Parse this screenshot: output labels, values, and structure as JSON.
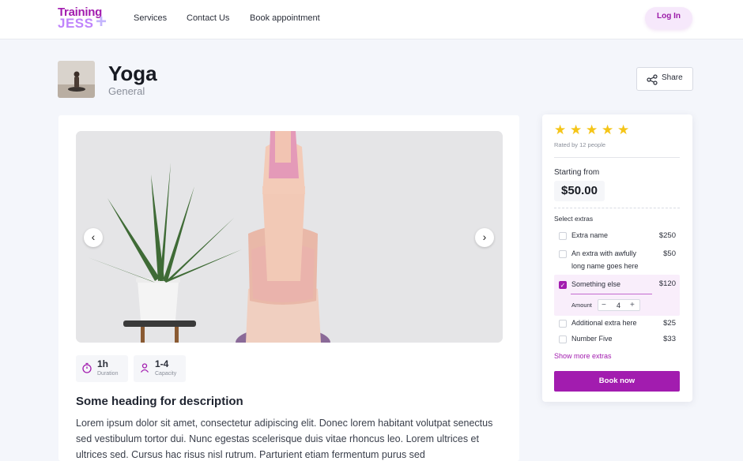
{
  "nav": {
    "logo_line1": "Training",
    "logo_line2": "JESS",
    "logo_plus": "+",
    "links": [
      "Services",
      "Contact Us",
      "Book appointment"
    ],
    "login": "Log In"
  },
  "service": {
    "title": "Yoga",
    "category": "General",
    "share": "Share"
  },
  "gallery": {
    "prev": "‹",
    "next": "›"
  },
  "stats": [
    {
      "value": "1h",
      "label": "Duration",
      "icon": "stopwatch-icon"
    },
    {
      "value": "1-4",
      "label": "Capacity",
      "icon": "person-icon"
    }
  ],
  "description": {
    "heading": "Some heading for description",
    "body": "Lorem ipsum dolor sit amet, consectetur adipiscing elit. Donec lorem habitant volutpat senectus sed vestibulum tortor dui. Nunc egestas scelerisque duis vitae rhoncus leo. Lorem ultrices et ultrices sed. Cursus hac risus nisl rutrum. Parturient etiam fermentum purus sed"
  },
  "booking": {
    "rating_stars": 5,
    "rated_by": "Rated by 12 people",
    "starting_label": "Starting from",
    "price": "$50.00",
    "extras_label": "Select extras",
    "extras": [
      {
        "name": "Extra name",
        "price": "$250",
        "checked": false
      },
      {
        "name": "An extra with awfully long name goes here",
        "price": "$50",
        "checked": false
      },
      {
        "name": "Something else",
        "price": "$120",
        "checked": true
      },
      {
        "name": "Additional extra here",
        "price": "$25",
        "checked": false
      },
      {
        "name": "Number Five",
        "price": "$33",
        "checked": false
      }
    ],
    "amount_label": "Amount",
    "amount_minus": "−",
    "amount_value": "4",
    "amount_plus": "+",
    "show_more": "Show more extras",
    "book": "Book now",
    "accent_color": "#a21caf",
    "star_color": "#f5c518"
  }
}
